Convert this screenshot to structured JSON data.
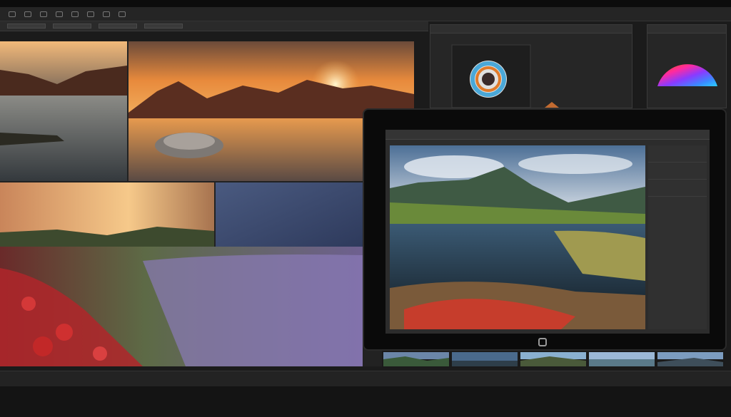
{
  "toolbar": {
    "icons": [
      "move-icon",
      "lasso-icon",
      "crop-icon",
      "brush-icon",
      "eraser-icon",
      "text-icon",
      "zoom-icon",
      "hand-icon"
    ]
  },
  "options": {
    "fields": [
      "",
      "",
      "",
      ""
    ]
  },
  "panels": {
    "color_panel": {
      "tab_label": ""
    },
    "wheel_panel": {
      "tab_label": ""
    }
  },
  "laptop": {
    "window_title": ""
  },
  "filmstrip": {
    "count": 5
  },
  "colors": {
    "accent": "#e07a2a",
    "panel_bg": "#262626",
    "chrome_bg": "#1b1b1b"
  }
}
